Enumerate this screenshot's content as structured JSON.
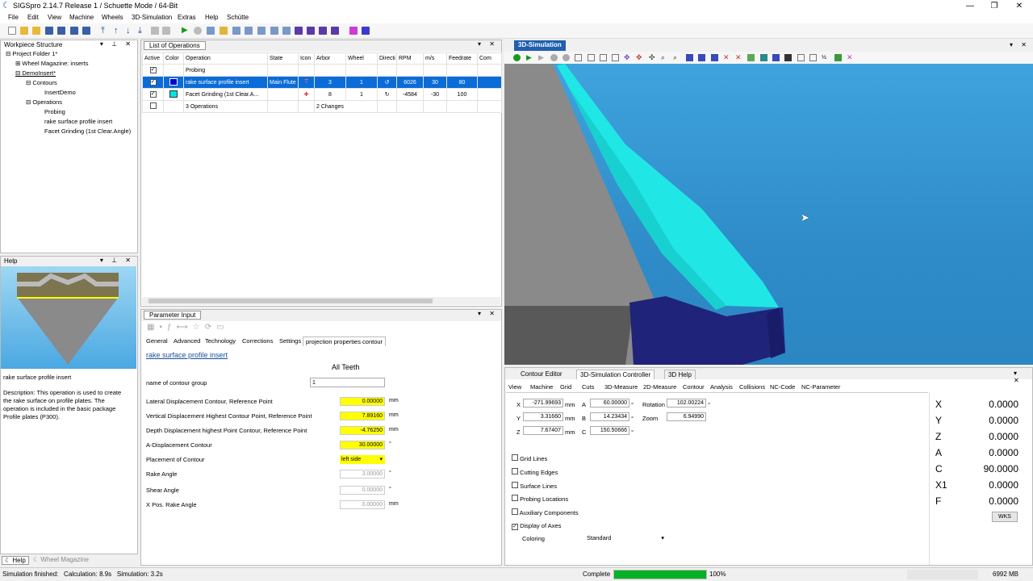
{
  "window": {
    "title": "SIGSpro 2.14.7 Release 1 / Schuette Mode / 64-Bit"
  },
  "menu": [
    "File",
    "Edit",
    "View",
    "Machine",
    "Wheels",
    "3D-Simulation",
    "Extras",
    "Help",
    "Schütte"
  ],
  "workpiece": {
    "title": "Workpiece Structure",
    "items": [
      "Project Folder 1*",
      "Wheel Magazine: inserts",
      "DemoInsert*",
      "Contours",
      "InsertDemo",
      "Operations",
      "Probing",
      "rake surface profile insert",
      "Facet Grinding (1st Clear.Angle)"
    ]
  },
  "help": {
    "title": "Help",
    "heading": "rake surface profile insert",
    "description": "Description: This operation is used to create the rake surface on profile plates. The operation is included in the basic package Profile plates (P300).",
    "bottom_tabs": [
      "Help",
      "Wheel Magazine"
    ]
  },
  "operations": {
    "title": "List of Operations",
    "columns": [
      "Active",
      "Color",
      "Operation",
      "State",
      "Icon",
      "Arbor",
      "Wheel",
      "Directi",
      "RPM",
      "m/s",
      "Feedrate",
      "Com"
    ],
    "rows": [
      {
        "active": "✓",
        "color": "",
        "operation": "Probing",
        "state": "",
        "arbor": "",
        "wheel": "",
        "rpm": "",
        "ms": "",
        "feed": ""
      },
      {
        "active": "✓",
        "color": "#0000cc",
        "operation": "rake surface profile insert",
        "state": "Main Flute",
        "arbor": "3",
        "wheel": "1",
        "rpm": "6026",
        "ms": "30",
        "feed": "80"
      },
      {
        "active": "✓",
        "color": "#00e5e5",
        "operation": "Facet Grinding (1st Clear.A...",
        "state": "",
        "arbor": "8",
        "wheel": "1",
        "rpm": "-4584",
        "ms": "-30",
        "feed": "100"
      },
      {
        "active": "",
        "color": "",
        "operation": "3 Operations",
        "state": "",
        "arbor": "2 Changes",
        "wheel": "",
        "rpm": "",
        "ms": "",
        "feed": ""
      }
    ]
  },
  "parameter": {
    "title": "Parameter Input",
    "tabs": [
      "General",
      "Advanced",
      "Technology",
      "Corrections",
      "Settings",
      "projection properties contour"
    ],
    "heading": "rake surface profile insert",
    "group_title": "All Teeth",
    "contour_group_label": "name of contour group",
    "contour_group_value": "1",
    "rows": [
      {
        "label": "Lateral Displacement Contour, Reference Point",
        "value": "0.00000",
        "unit": "mm",
        "style": "y"
      },
      {
        "label": "Vertical Displacement Highest Contour Point, Reference Point",
        "value": "7.89160",
        "unit": "mm",
        "style": "y"
      },
      {
        "label": "Depth Displacement highest Point Contour, Reference Point",
        "value": "-4.76250",
        "unit": "mm",
        "style": "y"
      },
      {
        "label": "A-Displacement Contour",
        "value": "30.00000",
        "unit": "°",
        "style": "y"
      },
      {
        "label": "Placement of Contour",
        "value": "left side",
        "unit": "",
        "style": "sel"
      },
      {
        "label": "Rake Angle",
        "value": "3.00000",
        "unit": "°",
        "style": "g"
      },
      {
        "label": "Shear Angle",
        "value": "0.00000",
        "unit": "°",
        "style": "g"
      },
      {
        "label": "X Pos. Rake Angle",
        "value": "0.00000",
        "unit": "mm",
        "style": "g"
      }
    ]
  },
  "simulation": {
    "title": "3D-Simulation"
  },
  "controller": {
    "tabs": [
      "Contour Editor",
      "3D-Simulation Controller",
      "3D Help"
    ],
    "subtabs": [
      "View",
      "Machine",
      "Grid",
      "Cuts",
      "3D-Measure",
      "2D-Measure",
      "Contour",
      "Analysis",
      "Collisions",
      "NC-Code",
      "NC-Parameter"
    ],
    "coords": [
      {
        "l": "X",
        "v": "-271.99693",
        "u": "mm",
        "l2": "A",
        "v2": "60.00000",
        "u2": "°",
        "l3": "Rotation",
        "v3": "102.00224",
        "u3": "°"
      },
      {
        "l": "Y",
        "v": "3.31660",
        "u": "mm",
        "l2": "B",
        "v2": "14.23434",
        "u2": "°",
        "l3": "Zoom",
        "v3": "6.94990",
        "u3": ""
      },
      {
        "l": "Z",
        "v": "7.67407",
        "u": "mm",
        "l2": "C",
        "v2": "150.50666",
        "u2": "°",
        "l3": "",
        "v3": "",
        "u3": ""
      }
    ],
    "checkboxes": [
      {
        "label": "Grid Lines",
        "checked": ""
      },
      {
        "label": "Cutting Edges",
        "checked": ""
      },
      {
        "label": "Surface Lines",
        "checked": ""
      },
      {
        "label": "Probing Locations",
        "checked": ""
      },
      {
        "label": "Auxiliary Components",
        "checked": ""
      },
      {
        "label": "Display of Axes",
        "checked": "✓"
      }
    ],
    "coloring_label": "Coloring",
    "coloring_value": "Standard"
  },
  "axes": [
    {
      "name": "X",
      "value": "0.0000"
    },
    {
      "name": "Y",
      "value": "0.0000"
    },
    {
      "name": "Z",
      "value": "0.0000"
    },
    {
      "name": "A",
      "value": "0.0000"
    },
    {
      "name": "C",
      "value": "90.0000"
    },
    {
      "name": "X1",
      "value": "0.0000"
    },
    {
      "name": "F",
      "value": "0.0000"
    }
  ],
  "wks_label": "WKS",
  "status": {
    "left": "Simulation finished:   Calculation: 8.9s   Simulation: 3.2s",
    "complete": "Complete",
    "progress": 100,
    "progress_text": "100%",
    "memory": "6992 MB"
  }
}
